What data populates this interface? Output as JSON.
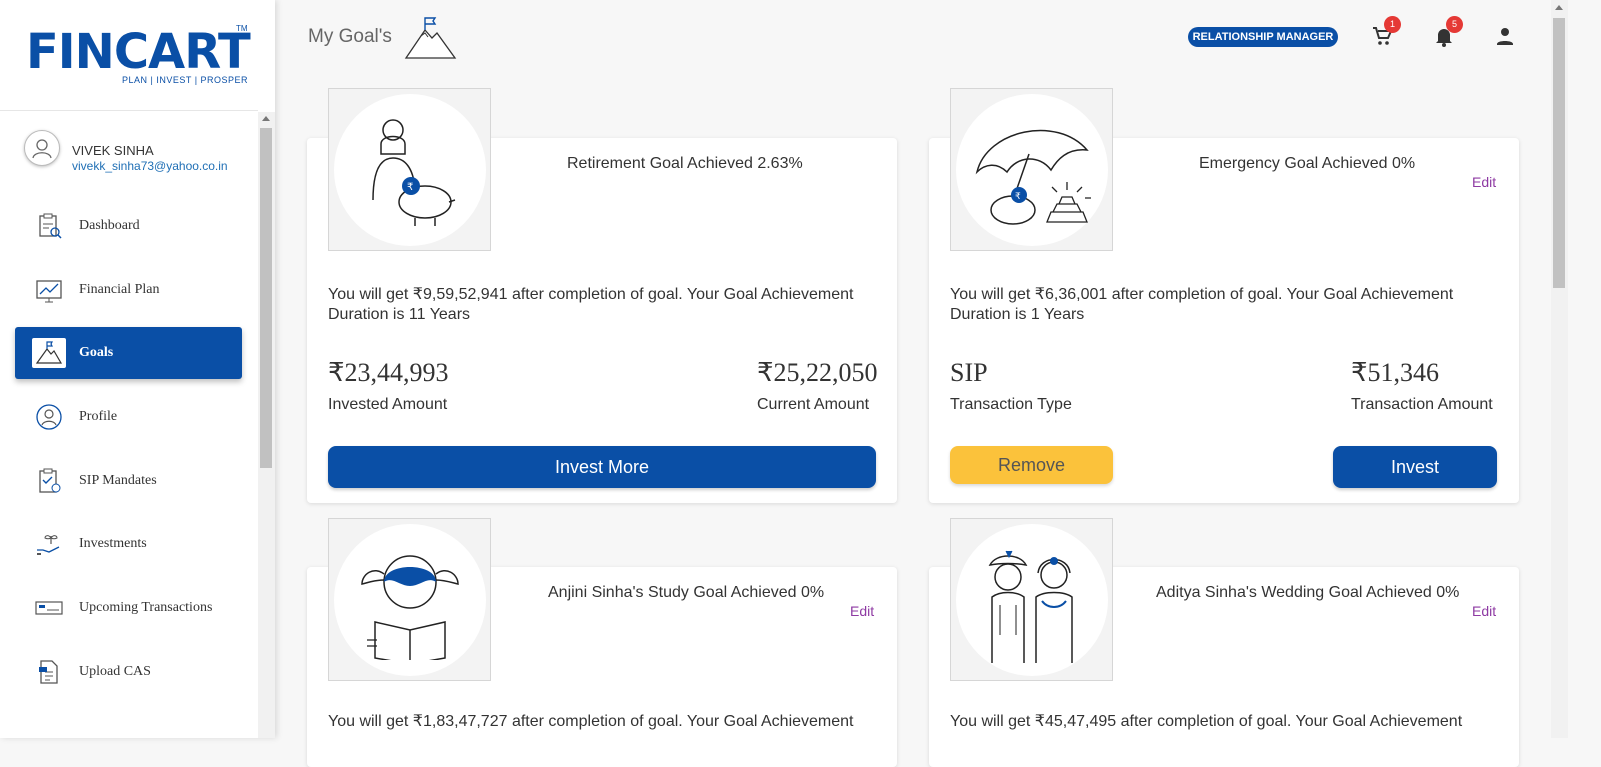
{
  "brand": {
    "name": "FINCART",
    "tagline": "PLAN | INVEST | PROSPER",
    "tm": "TM",
    "color": "#0a4fa6"
  },
  "user": {
    "name": "VIVEK SINHA",
    "email": "vivekk_sinha73@yahoo.co.in"
  },
  "nav": [
    {
      "label": "Dashboard",
      "icon": "dashboard-icon",
      "active": false
    },
    {
      "label": "Financial Plan",
      "icon": "financial-plan-icon",
      "active": false
    },
    {
      "label": "Goals",
      "icon": "goals-icon",
      "active": true
    },
    {
      "label": "Profile",
      "icon": "profile-icon",
      "active": false
    },
    {
      "label": "SIP Mandates",
      "icon": "sip-mandates-icon",
      "active": false
    },
    {
      "label": "Investments",
      "icon": "investments-icon",
      "active": false
    },
    {
      "label": "Upcoming Transactions",
      "icon": "upcoming-transactions-icon",
      "active": false
    },
    {
      "label": "Upload CAS",
      "icon": "upload-cas-icon",
      "active": false
    }
  ],
  "header": {
    "title": "My Goal's",
    "rm_label": "RELATIONSHIP  MANAGER",
    "cart_count": "1",
    "notification_count": "5"
  },
  "goals": [
    {
      "title": "Retirement Goal Achieved 2.63%",
      "edit": "",
      "description": "You will get ₹9,59,52,941 after completion of goal. Your Goal Achievement Duration is 11 Years",
      "left_value": "₹23,44,993",
      "left_label": "Invested Amount",
      "right_value": "₹25,22,050",
      "right_label": "Current Amount",
      "primary_button": "Invest More"
    },
    {
      "title": "Emergency Goal Achieved 0%",
      "edit": "Edit",
      "description": "You will get ₹6,36,001 after completion of goal. Your Goal Achievement Duration is 1 Years",
      "left_value": "SIP",
      "left_label": "Transaction Type",
      "right_value": "₹51,346",
      "right_label": "Transaction Amount",
      "secondary_button": "Remove",
      "primary_button": "Invest"
    },
    {
      "title": "Anjini Sinha's Study Goal Achieved 0%",
      "edit": "Edit",
      "description": "You will get ₹1,83,47,727 after completion of goal. Your Goal Achievement"
    },
    {
      "title": "Aditya Sinha's Wedding Goal Achieved 0%",
      "edit": "Edit",
      "description": "You will get ₹45,47,495 after completion of goal. Your Goal Achievement"
    }
  ]
}
